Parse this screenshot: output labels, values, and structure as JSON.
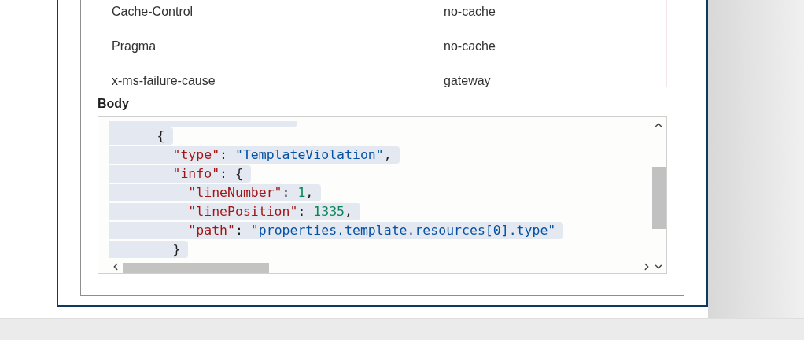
{
  "headers": {
    "rows": [
      {
        "name": "Cache-Control",
        "value": "no-cache"
      },
      {
        "name": "Pragma",
        "value": "no-cache"
      },
      {
        "name": "x-ms-failure-cause",
        "value": "gateway"
      }
    ]
  },
  "body": {
    "label": "Body",
    "lines": [
      [
        {
          "kind": "punct",
          "text": "      {"
        }
      ],
      [
        {
          "kind": "key",
          "text": "        \"type\""
        },
        {
          "kind": "punct",
          "text": ": "
        },
        {
          "kind": "string",
          "text": "\"TemplateViolation\""
        },
        {
          "kind": "punct",
          "text": ","
        }
      ],
      [
        {
          "kind": "key",
          "text": "        \"info\""
        },
        {
          "kind": "punct",
          "text": ": {"
        }
      ],
      [
        {
          "kind": "key",
          "text": "          \"lineNumber\""
        },
        {
          "kind": "punct",
          "text": ": "
        },
        {
          "kind": "number",
          "text": "1"
        },
        {
          "kind": "punct",
          "text": ","
        }
      ],
      [
        {
          "kind": "key",
          "text": "          \"linePosition\""
        },
        {
          "kind": "punct",
          "text": ": "
        },
        {
          "kind": "number",
          "text": "1335"
        },
        {
          "kind": "punct",
          "text": ","
        }
      ],
      [
        {
          "kind": "key",
          "text": "          \"path\""
        },
        {
          "kind": "punct",
          "text": ": "
        },
        {
          "kind": "string",
          "text": "\"properties.template.resources[0].type\""
        }
      ],
      [
        {
          "kind": "punct",
          "text": "        }"
        }
      ]
    ]
  }
}
